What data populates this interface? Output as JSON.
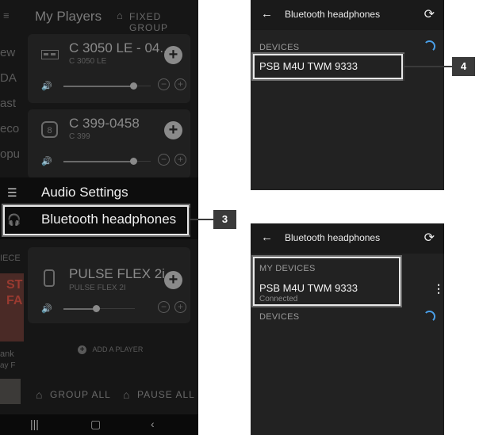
{
  "left_screen": {
    "header_title": "My Players",
    "fixed_group_label": "FIXED GROUP",
    "side_fragments": [
      "ew",
      "DA",
      "ast",
      "eco",
      "opu",
      "IECE",
      "ST",
      "FA",
      "ank",
      "ay F"
    ],
    "players": [
      {
        "name": "C 3050 LE - 04...",
        "model": "C 3050 LE",
        "icon": "receiver-icon"
      },
      {
        "name": "C 399-0458",
        "model": "C 399",
        "icon": "amplifier-icon"
      },
      {
        "name": "PULSE FLEX 2i ...",
        "model": "PULSE FLEX 2I",
        "icon": "speaker-icon"
      }
    ],
    "menu": {
      "audio_settings": "Audio Settings",
      "bluetooth_headphones": "Bluetooth headphones"
    },
    "add_player": "ADD A PLAYER",
    "group_all": "GROUP ALL",
    "pause_all": "PAUSE ALL",
    "callout_number": "3"
  },
  "right_top": {
    "title": "Bluetooth headphones",
    "devices_header": "DEVICES",
    "device_name": "PSB M4U TWM  9333",
    "callout_number": "4"
  },
  "right_bottom": {
    "title": "Bluetooth headphones",
    "my_devices_header": "MY DEVICES",
    "device_name": "PSB M4U TWM  9333",
    "device_status": "Connected",
    "devices_header": "DEVICES"
  },
  "colors": {
    "accent_spinner": "#4a9fe8",
    "callout_bg": "#3a3a3a"
  }
}
